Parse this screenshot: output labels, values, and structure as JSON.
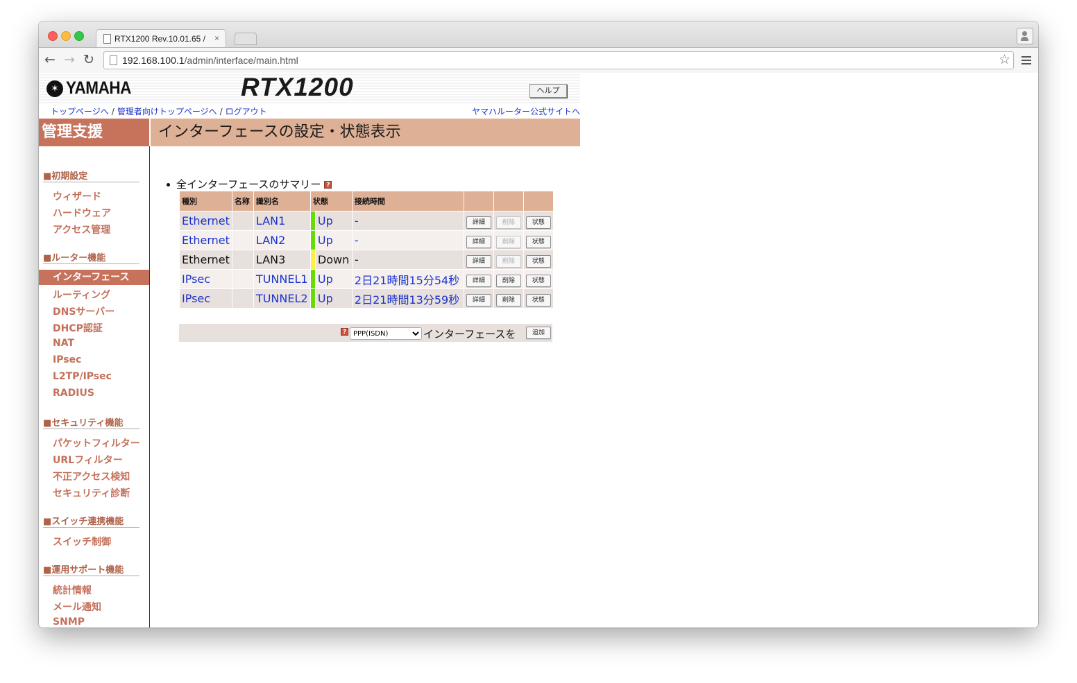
{
  "browser": {
    "tab_title": "RTX1200 Rev.10.01.65 / —",
    "tab_close": "×",
    "url_host": "192.168.100.1",
    "url_path": "/admin/interface/main.html"
  },
  "header": {
    "brand": "YAMAHA",
    "model": "RTX1200",
    "help_label": "ヘルプ",
    "links": {
      "top": "トップページへ",
      "admin_top": "管理者向けトップページへ",
      "logout": "ログアウト",
      "official": "ヤマハルーター公式サイトへ",
      "separator": "/"
    }
  },
  "sidebar": {
    "title": "管理支援",
    "sections": [
      {
        "label": "■初期設定",
        "items": [
          "ウィザード",
          "ハードウェア",
          "アクセス管理"
        ]
      },
      {
        "label": "■ルーター機能",
        "items": [
          "インターフェース",
          "ルーティング",
          "DNSサーバー",
          "DHCP認証",
          "NAT",
          "IPsec",
          "L2TP/IPsec",
          "RADIUS"
        ]
      },
      {
        "label": "■セキュリティ機能",
        "items": [
          "パケットフィルター",
          "URLフィルター",
          "不正アクセス検知",
          "セキュリティ診断"
        ]
      },
      {
        "label": "■スイッチ連携機能",
        "items": [
          "スイッチ制御"
        ]
      },
      {
        "label": "■運用サポート機能",
        "items": [
          "統計情報",
          "メール通知",
          "SNMP"
        ]
      }
    ],
    "active_item": "インターフェース"
  },
  "main": {
    "title": "インターフェースの設定・状態表示",
    "summary_label": "全インターフェースのサマリー",
    "help_icon": "?",
    "table": {
      "headers": [
        "種別",
        "名称",
        "識別名",
        "状態",
        "接続時間"
      ],
      "rows": [
        {
          "type": "Ethernet",
          "name": "",
          "id": "LAN1",
          "state": "Up",
          "time": "-",
          "state_color": "#66dd00",
          "linked": true,
          "delete_enabled": false
        },
        {
          "type": "Ethernet",
          "name": "",
          "id": "LAN2",
          "state": "Up",
          "time": "-",
          "state_color": "#66dd00",
          "linked": true,
          "delete_enabled": false
        },
        {
          "type": "Ethernet",
          "name": "",
          "id": "LAN3",
          "state": "Down",
          "time": "-",
          "state_color": "#ffee44",
          "linked": false,
          "delete_enabled": false
        },
        {
          "type": "IPsec",
          "name": "",
          "id": "TUNNEL1",
          "state": "Up",
          "time": "2日21時間15分54秒",
          "state_color": "#66dd00",
          "linked": true,
          "delete_enabled": true
        },
        {
          "type": "IPsec",
          "name": "",
          "id": "TUNNEL2",
          "state": "Up",
          "time": "2日21時間13分59秒",
          "state_color": "#66dd00",
          "linked": true,
          "delete_enabled": true
        }
      ],
      "button_labels": {
        "detail": "詳細",
        "delete": "削除",
        "status": "状態"
      }
    },
    "add": {
      "selected": "PPP(ISDN)",
      "suffix": "インターフェースを",
      "button": "追加"
    }
  },
  "colors": {
    "accent": "#c7735c",
    "header_bg": "#deb095",
    "link": "#1a33cc",
    "state_up": "#66dd00",
    "state_down": "#ffee44"
  }
}
